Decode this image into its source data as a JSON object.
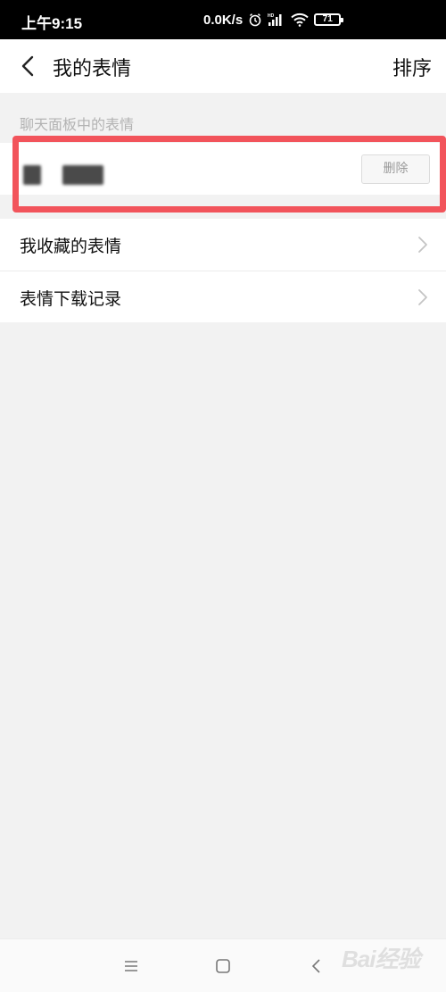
{
  "status_bar": {
    "time": "上午9:15",
    "network_speed": "0.0K/s",
    "battery_level": "71",
    "icons": [
      "alarm-icon",
      "hd-signal-icon",
      "wifi-icon",
      "battery-icon"
    ]
  },
  "header": {
    "title": "我的表情",
    "sort_label": "排序",
    "back_icon": "chevron-left-icon"
  },
  "chat_panel": {
    "section_title": "聊天面板中的表情",
    "delete_label": "删除"
  },
  "menu": {
    "items": [
      {
        "label": "我收藏的表情",
        "icon": "chevron-right-icon"
      },
      {
        "label": "表情下载记录",
        "icon": "chevron-right-icon"
      }
    ]
  },
  "bottom_nav": {
    "icons": [
      "menu-icon",
      "home-icon",
      "back-icon"
    ]
  },
  "watermark": {
    "text": "Bai经验"
  },
  "colors": {
    "highlight": "#f2545b",
    "background": "#f2f2f2",
    "surface": "#ffffff",
    "muted_text": "#b3b3b3"
  }
}
